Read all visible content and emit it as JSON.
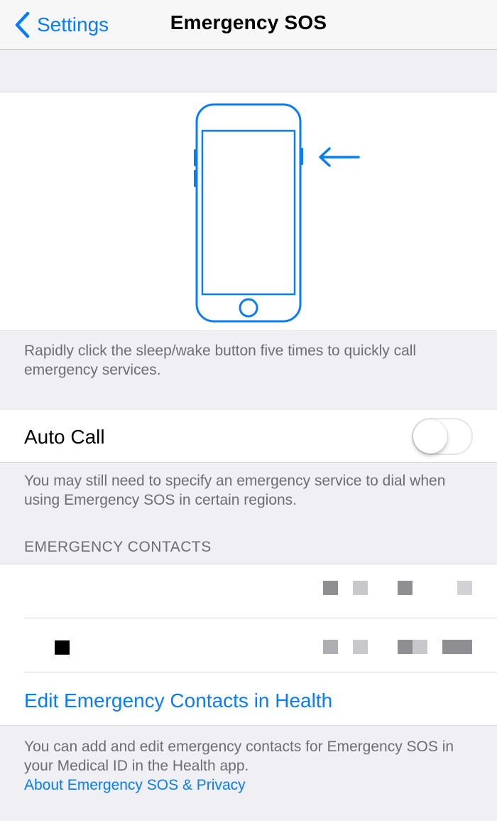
{
  "nav": {
    "back_label": "Settings",
    "title": "Emergency SOS",
    "back_icon": "chevron-left-icon"
  },
  "illustration": {
    "icon": "iphone-side-button-icon",
    "arrow_icon": "arrow-left-icon",
    "accent_color": "#0a7cf5"
  },
  "description": "Rapidly click the sleep/wake button five times to quickly call emergency services.",
  "auto_call": {
    "label": "Auto Call",
    "enabled": false
  },
  "auto_call_note": "You may still need to specify an emergency service to dial when using Emergency SOS in certain regions.",
  "contacts": {
    "header": "EMERGENCY CONTACTS",
    "edit_link": "Edit Emergency Contacts in Health"
  },
  "footer": {
    "text": "You can add and edit emergency contacts for Emergency SOS in your Medical ID in the Health app.",
    "privacy_link": "About Emergency SOS & Privacy"
  },
  "colors": {
    "link": "#0a7cf5",
    "background": "#efeff4",
    "secondary_text": "#6d6d72"
  }
}
